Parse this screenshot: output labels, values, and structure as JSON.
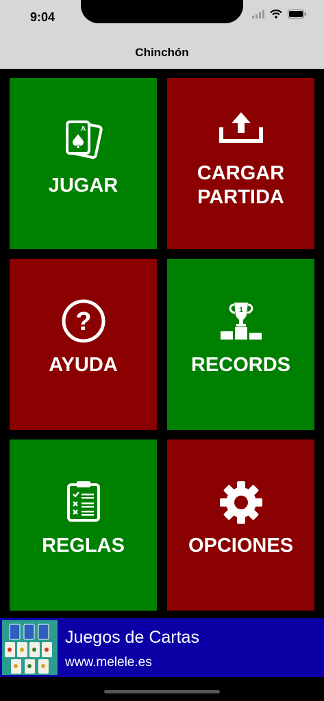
{
  "status_bar": {
    "time": "9:04"
  },
  "nav": {
    "title": "Chinchón"
  },
  "tiles": {
    "jugar": {
      "label": "JUGAR",
      "icon": "playing-cards-icon",
      "color": "#008000"
    },
    "cargar": {
      "label_line1": "CARGAR",
      "label_line2": "PARTIDA",
      "icon": "upload-icon",
      "color": "#8b0000"
    },
    "ayuda": {
      "label": "AYUDA",
      "icon": "question-mark-icon",
      "color": "#8b0000"
    },
    "records": {
      "label": "RECORDS",
      "icon": "trophy-podium-icon",
      "color": "#008000"
    },
    "reglas": {
      "label": "REGLAS",
      "icon": "clipboard-checklist-icon",
      "color": "#008000"
    },
    "opciones": {
      "label": "OPCIONES",
      "icon": "gear-icon",
      "color": "#8b0000"
    }
  },
  "banner": {
    "title": "Juegos de Cartas",
    "url": "www.melele.es",
    "background": "#0b00a6"
  }
}
